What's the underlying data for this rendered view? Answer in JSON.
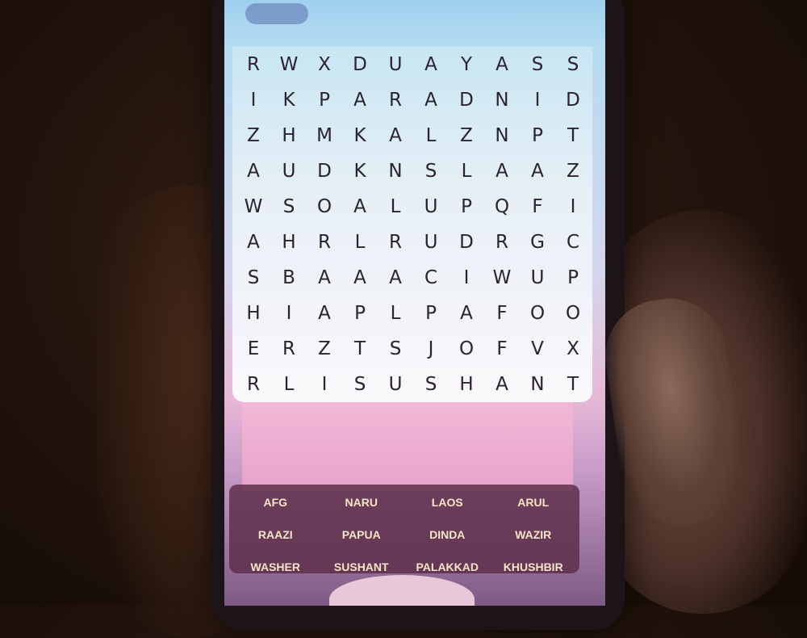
{
  "grid": [
    [
      "R",
      "W",
      "X",
      "D",
      "U",
      "A",
      "Y",
      "A",
      "S",
      "S"
    ],
    [
      "I",
      "K",
      "P",
      "A",
      "R",
      "A",
      "D",
      "N",
      "I",
      "D"
    ],
    [
      "Z",
      "H",
      "M",
      "K",
      "A",
      "L",
      "Z",
      "N",
      "P",
      "T"
    ],
    [
      "A",
      "U",
      "D",
      "K",
      "N",
      "S",
      "L",
      "A",
      "A",
      "Z"
    ],
    [
      "W",
      "S",
      "O",
      "A",
      "L",
      "U",
      "P",
      "Q",
      "F",
      "I"
    ],
    [
      "A",
      "H",
      "R",
      "L",
      "R",
      "U",
      "D",
      "R",
      "G",
      "C"
    ],
    [
      "S",
      "B",
      "A",
      "A",
      "A",
      "C",
      "I",
      "W",
      "U",
      "P"
    ],
    [
      "H",
      "I",
      "A",
      "P",
      "L",
      "P",
      "A",
      "F",
      "O",
      "O"
    ],
    [
      "E",
      "R",
      "Z",
      "T",
      "S",
      "J",
      "O",
      "F",
      "V",
      "X"
    ],
    [
      "R",
      "L",
      "I",
      "S",
      "U",
      "S",
      "H",
      "A",
      "N",
      "T"
    ]
  ],
  "words": [
    "AFG",
    "NARU",
    "LAOS",
    "ARUL",
    "RAAZI",
    "PAPUA",
    "DINDA",
    "WAZIR",
    "WASHER",
    "SUSHANT",
    "PALAKKAD",
    "KHUSHBIR"
  ]
}
